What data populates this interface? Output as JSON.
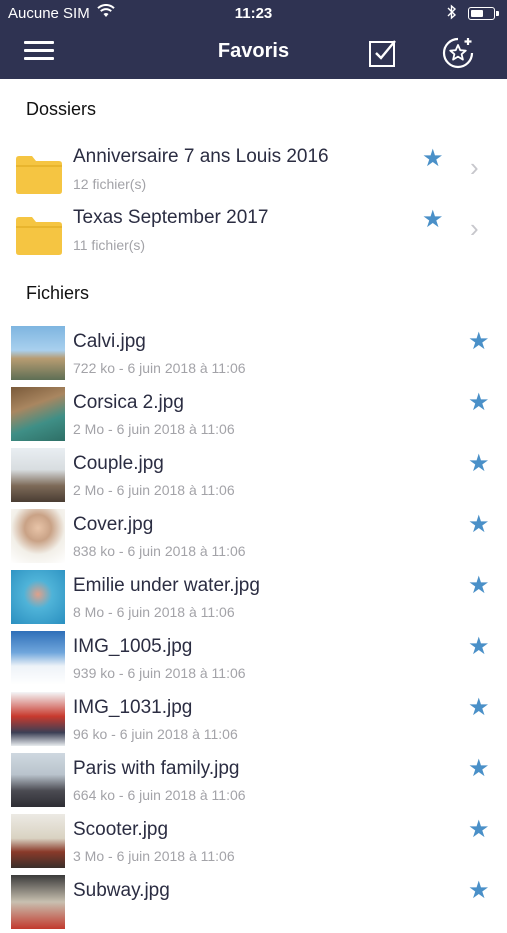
{
  "status_bar": {
    "carrier": "Aucune SIM",
    "time": "11:23",
    "wifi_icon": "wifi-icon",
    "bluetooth_icon": "bluetooth-icon",
    "battery_icon": "battery-icon"
  },
  "nav": {
    "title": "Favoris",
    "menu_icon": "menu-icon",
    "select_icon": "checkbox-icon",
    "favorites_icon": "star-badge-icon"
  },
  "folders_section": {
    "title": "Dossiers",
    "items": [
      {
        "name": "Anniversaire 7 ans Louis 2016",
        "subtitle": "12 fichier(s)",
        "favorite": true
      },
      {
        "name": "Texas September 2017",
        "subtitle": "11 fichier(s)",
        "favorite": true
      }
    ]
  },
  "files_section": {
    "title": "Fichiers",
    "items": [
      {
        "name": "Calvi.jpg",
        "meta": "722 ko - 6 juin 2018 à 11:06",
        "favorite": true
      },
      {
        "name": "Corsica 2.jpg",
        "meta": "2 Mo - 6 juin 2018 à 11:06",
        "favorite": true
      },
      {
        "name": "Couple.jpg",
        "meta": "2 Mo - 6 juin 2018 à 11:06",
        "favorite": true
      },
      {
        "name": "Cover.jpg",
        "meta": "838 ko - 6 juin 2018 à 11:06",
        "favorite": true
      },
      {
        "name": "Emilie under water.jpg",
        "meta": "8 Mo - 6 juin 2018 à 11:06",
        "favorite": true
      },
      {
        "name": "IMG_1005.jpg",
        "meta": "939 ko - 6 juin 2018 à 11:06",
        "favorite": true
      },
      {
        "name": "IMG_1031.jpg",
        "meta": "96 ko - 6 juin 2018 à 11:06",
        "favorite": true
      },
      {
        "name": "Paris with family.jpg",
        "meta": "664 ko - 6 juin 2018 à 11:06",
        "favorite": true
      },
      {
        "name": "Scooter.jpg",
        "meta": "3 Mo - 6 juin 2018 à 11:06",
        "favorite": true
      },
      {
        "name": "Subway.jpg",
        "meta": "",
        "favorite": true
      }
    ]
  },
  "colors": {
    "header": "#2f3352",
    "star": "#4a90c8",
    "folder": "#f5c542",
    "secondary_text": "#a3a3a8"
  }
}
